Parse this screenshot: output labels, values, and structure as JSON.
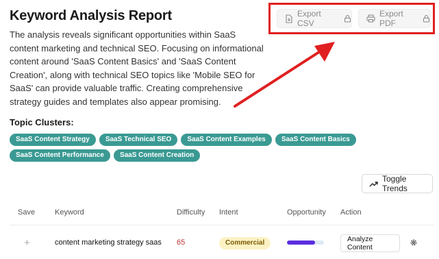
{
  "report": {
    "title": "Keyword Analysis Report",
    "summary": "The analysis reveals significant opportunities within SaaS content marketing and technical SEO. Focusing on informational content around 'SaaS Content Basics' and 'SaaS Content Creation', along with technical SEO topics like 'Mobile SEO for SaaS' can provide valuable traffic. Creating comprehensive strategy guides and templates also appear promising."
  },
  "export": {
    "csv_label": "Export CSV",
    "pdf_label": "Export PDF",
    "locked": true,
    "highlight_color": "#e02020"
  },
  "clusters": {
    "heading": "Topic Clusters:",
    "items": [
      "SaaS Content Strategy",
      "SaaS Technical SEO",
      "SaaS Content Examples",
      "SaaS Content Basics",
      "SaaS Content Performance",
      "SaaS Content Creation"
    ],
    "chip_color": "#3a9a93"
  },
  "toggle_trends_label": "Toggle Trends",
  "table": {
    "headers": {
      "save": "Save",
      "keyword": "Keyword",
      "difficulty": "Difficulty",
      "intent": "Intent",
      "opportunity": "Opportunity",
      "action": "Action"
    },
    "rows": [
      {
        "save_symbol": "+",
        "keyword": "content marketing strategy saas",
        "difficulty": "65",
        "intent": "Commercial",
        "opportunity_fraction": 0.75,
        "action": "Analyze Content"
      }
    ]
  },
  "icons": {
    "csv": "file-download-icon",
    "pdf": "printer-icon",
    "lock": "lock-icon",
    "trends": "trending-up-icon",
    "settings": "gear-icon"
  }
}
